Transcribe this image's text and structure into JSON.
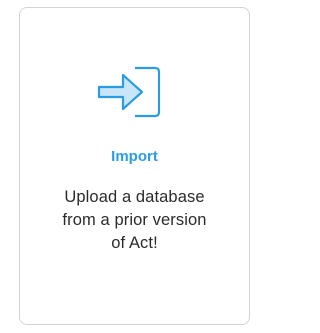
{
  "card": {
    "icon": "import-arrow-icon",
    "title": "Import",
    "description_lines": [
      "Upload a database",
      "from a prior version",
      "of Act!"
    ]
  },
  "colors": {
    "accent": "#2a9de2",
    "icon_fill": "#c8e6f7",
    "border": "#d4d4d4",
    "text": "#2b2b2b"
  }
}
